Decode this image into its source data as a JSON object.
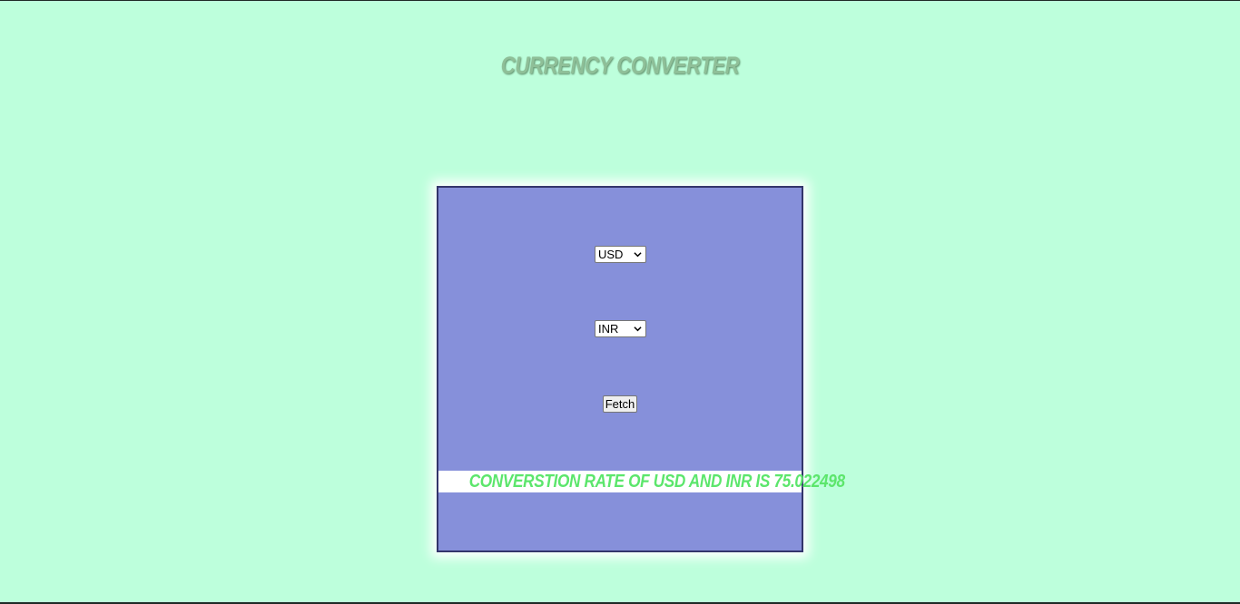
{
  "header": {
    "title": "Currency Converter"
  },
  "converter": {
    "from_currency": {
      "selected": "USD"
    },
    "to_currency": {
      "selected": "INR"
    },
    "fetch_label": "Fetch",
    "result_text": "Converstion rate of USD and INR is 75.022498"
  },
  "colors": {
    "page_background": "#bdffdc",
    "card_background": "#8690da",
    "title_color": "#8fbf98",
    "result_text_color": "#5ce66c"
  }
}
